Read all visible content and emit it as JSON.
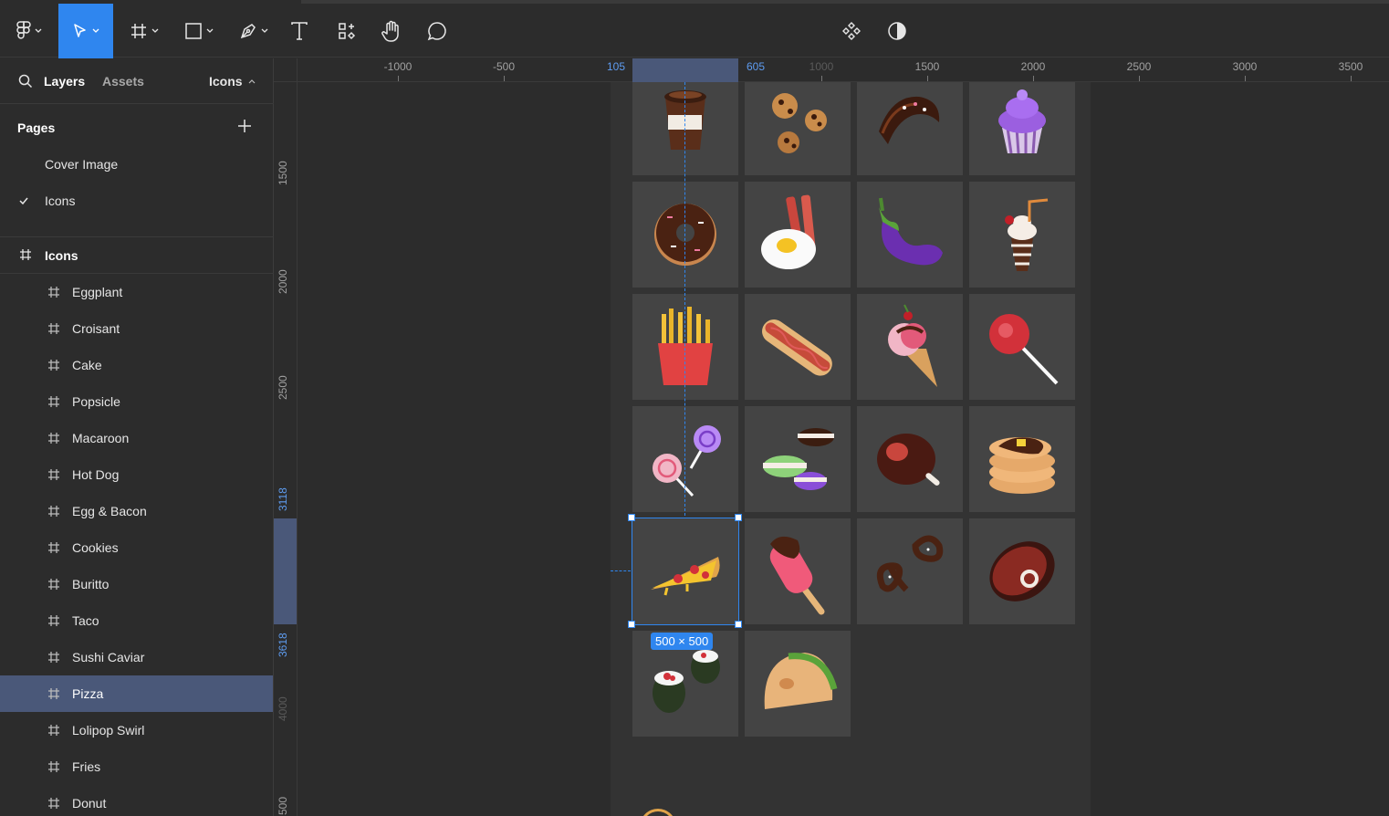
{
  "toolbar": {
    "tools": [
      "main-menu",
      "move",
      "frame",
      "shape",
      "pen",
      "text",
      "resources",
      "hand",
      "comment"
    ],
    "right_tools": [
      "component",
      "contrast"
    ]
  },
  "left_panel": {
    "tabs": {
      "layers": "Layers",
      "assets": "Assets",
      "page_selector": "Icons"
    },
    "pages_header": "Pages",
    "pages": [
      {
        "label": "Cover Image",
        "current": false
      },
      {
        "label": "Icons",
        "current": true
      }
    ],
    "frame_root": "Icons",
    "layers": [
      {
        "label": "Eggplant",
        "selected": false
      },
      {
        "label": "Croisant",
        "selected": false
      },
      {
        "label": "Cake",
        "selected": false
      },
      {
        "label": "Popsicle",
        "selected": false
      },
      {
        "label": "Macaroon",
        "selected": false
      },
      {
        "label": "Hot Dog",
        "selected": false
      },
      {
        "label": "Egg & Bacon",
        "selected": false
      },
      {
        "label": "Cookies",
        "selected": false
      },
      {
        "label": "Buritto",
        "selected": false
      },
      {
        "label": "Taco",
        "selected": false
      },
      {
        "label": "Sushi Caviar",
        "selected": false
      },
      {
        "label": "Pizza",
        "selected": true
      },
      {
        "label": "Lolipop Swirl",
        "selected": false
      },
      {
        "label": "Fries",
        "selected": false
      },
      {
        "label": "Donut",
        "selected": false
      }
    ]
  },
  "rulers": {
    "horizontal": [
      "-1000",
      "-500",
      "105",
      "605",
      "1000",
      "1500",
      "2000",
      "2500",
      "3000",
      "3500"
    ],
    "vertical": [
      "1500",
      "2000",
      "2500",
      "3118",
      "3618",
      "4000",
      "500"
    ]
  },
  "canvas": {
    "selection_size": "500 × 500",
    "accent_color": "#2f86ef",
    "icons": [
      [
        "coffee-cup",
        "cookies",
        "croissant",
        "cupcake"
      ],
      [
        "donut",
        "egg-bacon",
        "eggplant",
        "milkshake"
      ],
      [
        "fries",
        "hot-dog",
        "ice-cream-cone",
        "lollipop"
      ],
      [
        "lollipop-swirl",
        "macaroon",
        "ham",
        "pancakes"
      ],
      [
        "pizza",
        "popsicle",
        "pretzel",
        "steak"
      ],
      [
        "sushi-caviar",
        "taco"
      ]
    ]
  }
}
